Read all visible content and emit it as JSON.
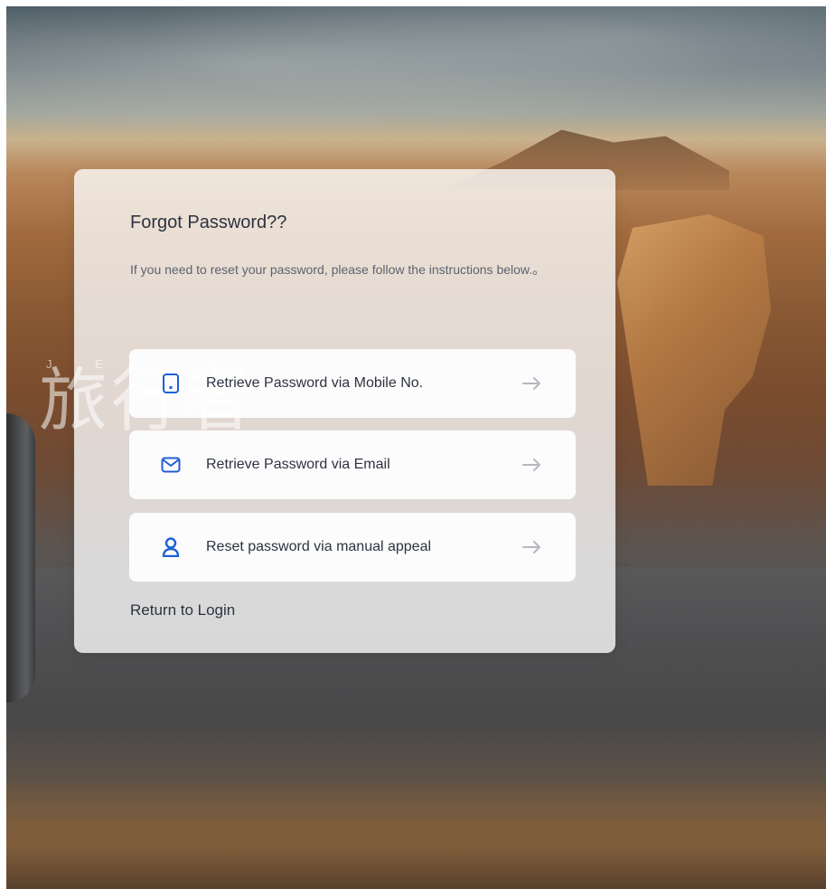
{
  "page": {
    "background_scene": "desert-road",
    "watermark": {
      "text": "旅行者",
      "letters": "J E"
    }
  },
  "card": {
    "title": "Forgot Password??",
    "description": "If you need to reset your password, please follow the instructions below.。",
    "options": [
      {
        "label": "Retrieve Password via Mobile No.",
        "icon": "mobile-phone-icon",
        "arrow_icon": "arrow-right-icon"
      },
      {
        "label": "Retrieve Password via Email",
        "icon": "envelope-icon",
        "arrow_icon": "arrow-right-icon"
      },
      {
        "label": "Reset password via manual appeal",
        "icon": "user-icon",
        "arrow_icon": "arrow-right-icon"
      }
    ],
    "return_link": "Return to Login"
  },
  "colors": {
    "icon_blue": "#1e5fd6",
    "text_dark": "#2d3340",
    "text_muted": "#5c6370",
    "arrow_gray": "#b4b8bf"
  }
}
